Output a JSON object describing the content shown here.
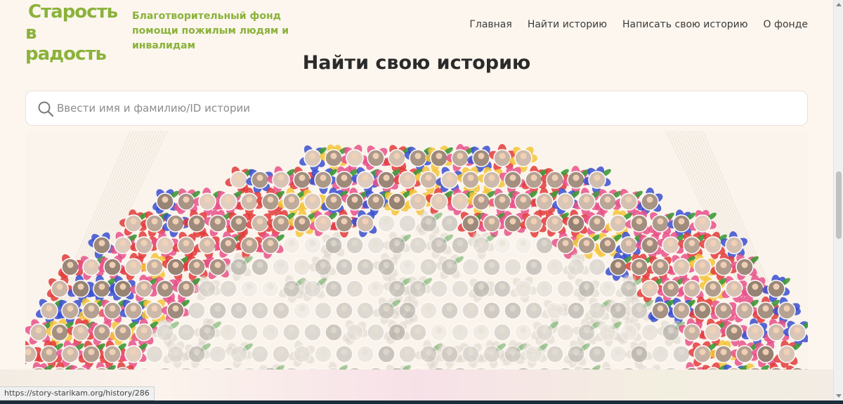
{
  "logo": {
    "line1": "Старость",
    "line2": "в радость"
  },
  "tagline": "Благотворительный фонд помощи пожилым людям и инвалидам",
  "nav": {
    "items": [
      "Главная",
      "Найти историю",
      "Написать свою историю",
      "О фонде"
    ]
  },
  "page_title": "Найти свою историю",
  "search": {
    "placeholder": "Ввести имя и фамилию/ID истории",
    "value": ""
  },
  "mosaic": {
    "description_icon": "portrait-flower-mosaic",
    "colors": {
      "pink": "#e8518a",
      "red": "#e23b3b",
      "blue": "#3a4fd0",
      "yellow": "#f3c43a",
      "leaf": "#3f9a3a",
      "faded": "#d9d2c8"
    }
  },
  "status_bar": {
    "url": "https://story-starikam.org/history/286"
  },
  "colors": {
    "brand_green": "#8ab23a",
    "brand_orange": "#f29a2e",
    "background": "#fdf6ee"
  }
}
